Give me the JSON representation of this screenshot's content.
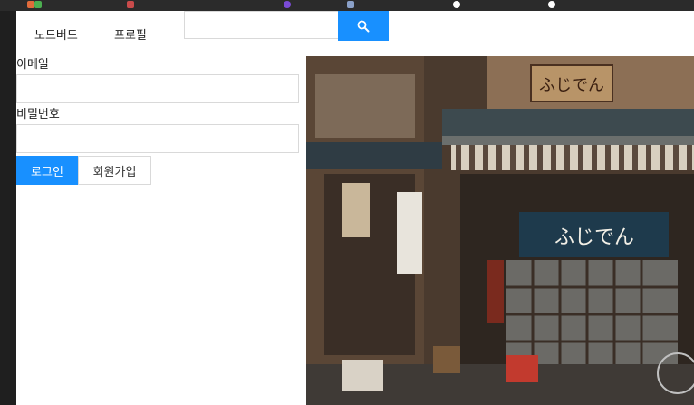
{
  "nav": {
    "items": [
      {
        "label": "노드버드"
      },
      {
        "label": "프로필"
      }
    ],
    "search": {
      "value": "",
      "placeholder": ""
    }
  },
  "login_form": {
    "email_label": "이메일",
    "email_value": "",
    "password_label": "비밀번호",
    "password_value": "",
    "login_button": "로그인",
    "signup_button": "회원가입"
  },
  "photo": {
    "sign_top": "ふじでん",
    "sign_noren": "ふじでん"
  },
  "colors": {
    "primary": "#1890ff",
    "border": "#d9d9d9"
  }
}
